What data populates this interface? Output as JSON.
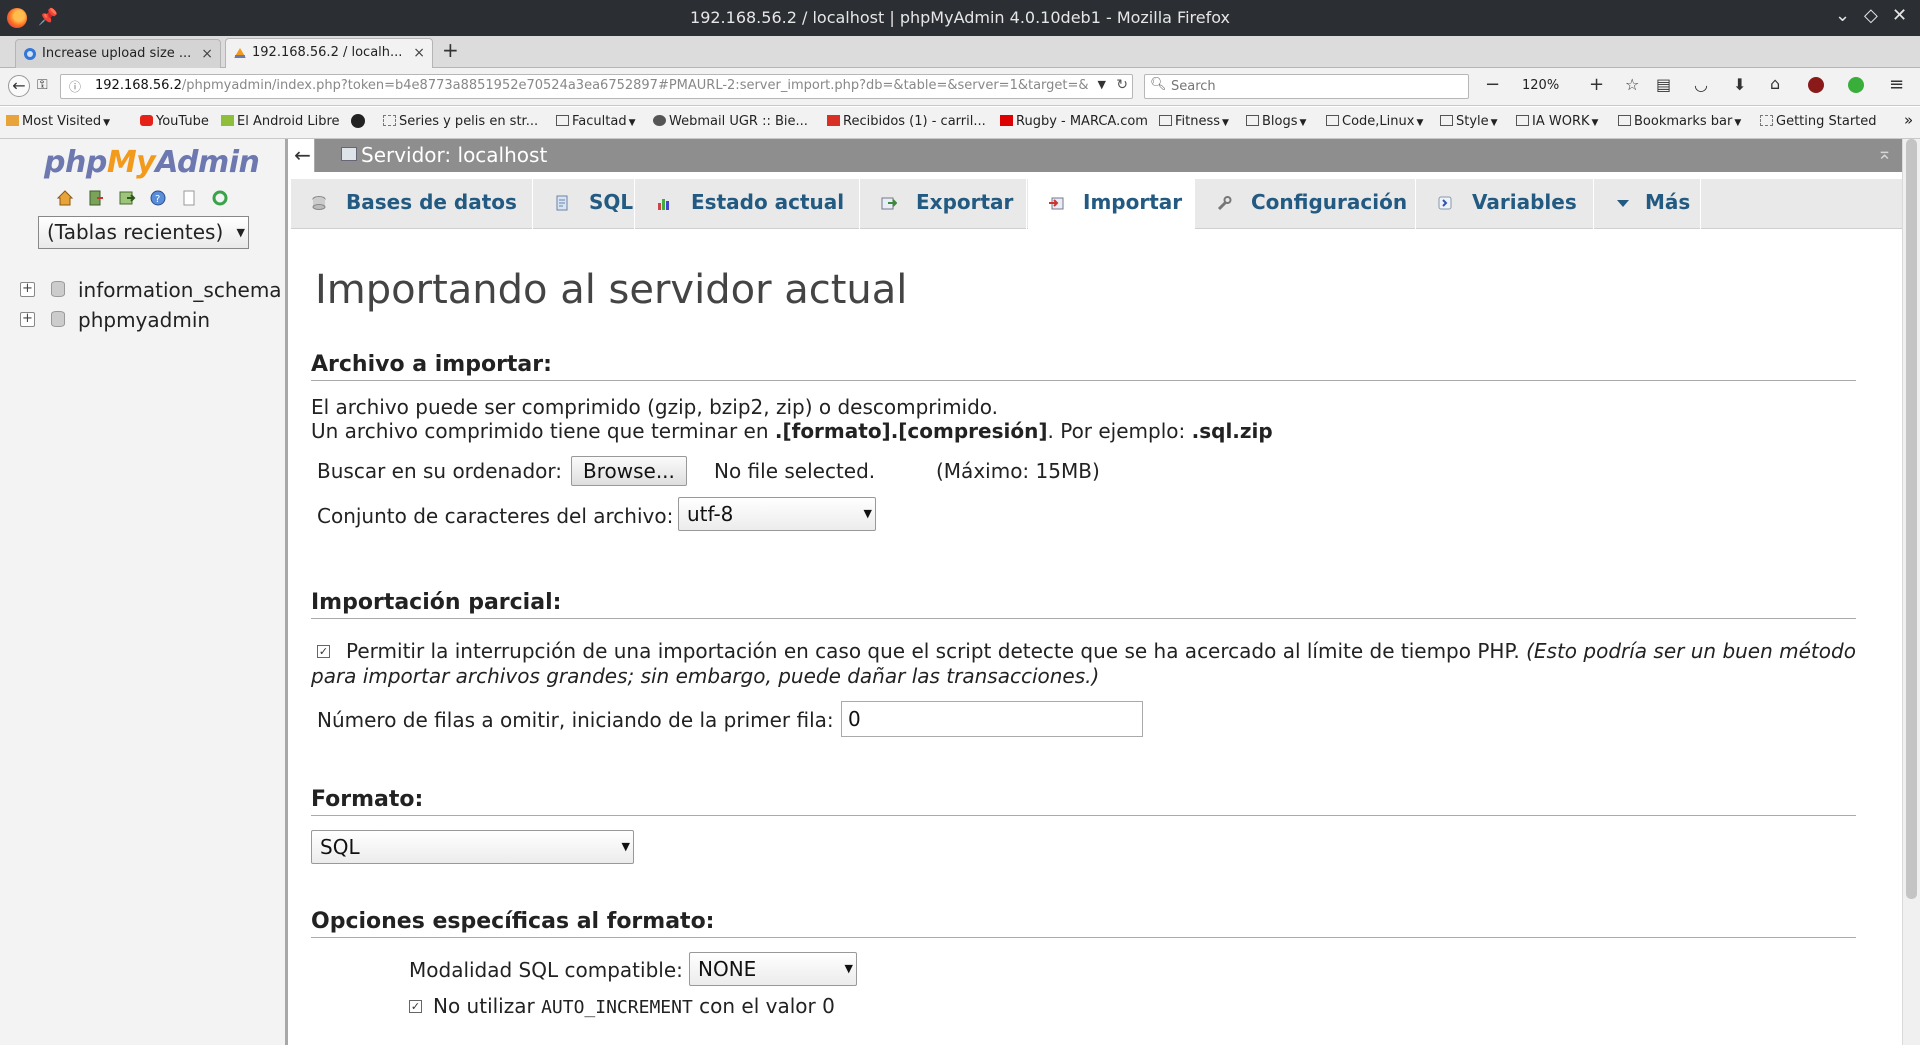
{
  "window": {
    "title": "192.168.56.2 / localhost | phpMyAdmin 4.0.10deb1 - Mozilla Firefox"
  },
  "tabs": [
    {
      "label": "Increase upload size ...",
      "close": "×",
      "icon": "edge-favicon-icon"
    },
    {
      "label": "192.168.56.2 / localh...",
      "close": "×",
      "icon": "pma-favicon-icon"
    }
  ],
  "newtab_label": "+",
  "navbar": {
    "url_host": "192.168.56.2",
    "url_rest": "/phpmyadmin/index.php?token=b4e8773a8851952e70524a3ea6752897#PMAURL-2:server_import.php?db=&table=&server=1&target=&",
    "search_placeholder": "Search",
    "zoom": "120%",
    "zoom_minus": "−",
    "zoom_plus": "+"
  },
  "bookmarks": [
    {
      "label": "Most Visited",
      "dropdown": true
    },
    {
      "label": "YouTube",
      "dropdown": false
    },
    {
      "label": "El Android Libre",
      "dropdown": false
    },
    {
      "label": "",
      "dropdown": false
    },
    {
      "label": "Series y pelis en str...",
      "dropdown": false
    },
    {
      "label": "Facultad",
      "dropdown": true
    },
    {
      "label": "Webmail UGR :: Bie...",
      "dropdown": false
    },
    {
      "label": "Recibidos (1) - carril...",
      "dropdown": false
    },
    {
      "label": "Rugby - MARCA.com",
      "dropdown": false
    },
    {
      "label": "Fitness",
      "dropdown": true
    },
    {
      "label": "Blogs",
      "dropdown": true
    },
    {
      "label": "Code,Linux",
      "dropdown": true
    },
    {
      "label": "Style",
      "dropdown": true
    },
    {
      "label": "IA WORK",
      "dropdown": true
    },
    {
      "label": "Bookmarks bar",
      "dropdown": true
    },
    {
      "label": "Getting Started",
      "dropdown": false
    }
  ],
  "bookmarks_overflow": "»",
  "left_panel": {
    "logo_php": "php",
    "logo_my": "My",
    "logo_admin": "Admin",
    "recent_tables": "(Tablas recientes)",
    "databases": [
      "information_schema",
      "phpmyadmin"
    ]
  },
  "server_bar": {
    "title": "Servidor: localhost"
  },
  "menu_tabs": [
    {
      "label": "Bases de datos",
      "icon": "database-icon"
    },
    {
      "label": "SQL",
      "icon": "sql-icon"
    },
    {
      "label": "Estado actual",
      "icon": "status-chart-icon"
    },
    {
      "label": "Exportar",
      "icon": "export-icon"
    },
    {
      "label": "Importar",
      "icon": "import-icon",
      "active": true
    },
    {
      "label": "Configuración",
      "icon": "wrench-icon"
    },
    {
      "label": "Variables",
      "icon": "variables-icon"
    },
    {
      "label": "Más",
      "icon": "triangle-down-icon"
    }
  ],
  "main": {
    "page_title": "Importando al servidor actual",
    "file_section": {
      "heading": "Archivo a importar:",
      "line1": "El archivo puede ser comprimido (gzip, bzip2, zip) o descomprimido.",
      "line2_prefix": "Un archivo comprimido tiene que terminar en ",
      "line2_bold": ".[formato].[compresión]",
      "line2_mid": ". Por ejemplo: ",
      "line2_example": ".sql.zip",
      "browse_label": "Buscar en su ordenador:",
      "browse_button": "Browse...",
      "no_file": "No file selected.",
      "max_size": "(Máximo: 15MB)",
      "charset_label": "Conjunto de caracteres del archivo:",
      "charset_value": "utf-8"
    },
    "partial_section": {
      "heading": "Importación parcial:",
      "allow_interrupt_text": "Permitir la interrupción de una importación en caso que el script detecte que se ha acercado al límite de tiempo PHP.",
      "allow_interrupt_note_1": "(Esto podría ser un buen método",
      "allow_interrupt_note_2": "para importar archivos grandes; sin embargo, puede dañar las transacciones.)",
      "allow_interrupt_checked": true,
      "skip_rows_label": "Número de filas a omitir, iniciando de la primer fila:",
      "skip_rows_value": "0"
    },
    "format_section": {
      "heading": "Formato:",
      "format_value": "SQL"
    },
    "format_options_section": {
      "heading": "Opciones específicas al formato:",
      "sql_compat_label": "Modalidad SQL compatible:",
      "sql_compat_value": "NONE",
      "no_auto_inc_prefix": "No utilizar ",
      "no_auto_inc_code": "AUTO_INCREMENT",
      "no_auto_inc_suffix": " con el valor 0",
      "no_auto_inc_checked": true
    }
  },
  "colors": {
    "menu_text": "#235a81",
    "server_bar": "#8e8e8e",
    "logo_orange": "#f29a1b",
    "logo_blue": "#6c78af"
  }
}
